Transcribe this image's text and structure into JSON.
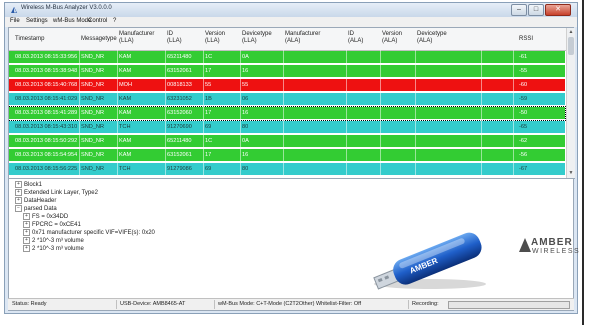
{
  "window": {
    "title": "Wireless M-Bus Analyzer V3.0.0.0",
    "buttons": {
      "minimize": "–",
      "maximize": "□",
      "close": "✕"
    }
  },
  "menu": [
    "File",
    "Settings",
    "wM-Bus Mode",
    "Control",
    "?"
  ],
  "table": {
    "headers": [
      "Timestamp",
      "Messagetype",
      "Manufacturer\n(LLA)",
      "ID\n(LLA)",
      "Version\n(LLA)",
      "Devicetype\n(LLA)",
      "Manufacturer\n(ALA)",
      "ID\n(ALA)",
      "Version\n(ALA)",
      "Devicetype\n(ALA)",
      "RSSI"
    ],
    "rows": [
      {
        "color": "green",
        "cells": [
          "08.03.2013 08:15:33:956",
          "SND_NR",
          "KAM",
          "65211480",
          "1C",
          "0A",
          "",
          "",
          "",
          "",
          "-61"
        ]
      },
      {
        "color": "green",
        "cells": [
          "08.03.2013 08:15:38:948",
          "SND_NR",
          "KAM",
          "63152061",
          "17",
          "16",
          "",
          "",
          "",
          "",
          "-55"
        ]
      },
      {
        "color": "red",
        "cells": [
          "08.03.2013 08:15:40:768",
          "SND_NR",
          "MOH",
          "00818133",
          "55",
          "55",
          "",
          "",
          "",
          "",
          "-60"
        ]
      },
      {
        "color": "teal",
        "cells": [
          "08.03.2013 08:15:41:029",
          "SND_NR",
          "KAM",
          "63231052",
          "1B",
          "06",
          "",
          "",
          "",
          "",
          "-59"
        ]
      },
      {
        "color": "green",
        "cells": [
          "08.03.2013 08:15:41:289",
          "SND_NR",
          "KAM",
          "63152060",
          "17",
          "16",
          "",
          "",
          "",
          "",
          "-50"
        ]
      },
      {
        "color": "teal",
        "cells": [
          "08.03.2013 08:15:43:310",
          "SND_NR",
          "TCH",
          "91270690",
          "69",
          "80",
          "",
          "",
          "",
          "",
          "-65"
        ]
      },
      {
        "color": "green",
        "cells": [
          "08.03.2013 08:15:50:292",
          "SND_NR",
          "KAM",
          "65211480",
          "1C",
          "0A",
          "",
          "",
          "",
          "",
          "-62"
        ]
      },
      {
        "color": "green",
        "cells": [
          "08.03.2013 08:15:54:954",
          "SND_NR",
          "KAM",
          "63152061",
          "17",
          "16",
          "",
          "",
          "",
          "",
          "-56"
        ]
      },
      {
        "color": "teal",
        "cells": [
          "08.03.2013 08:15:56:225",
          "SND_NR",
          "TCH",
          "91279086",
          "69",
          "80",
          "",
          "",
          "",
          "",
          "-67"
        ]
      }
    ]
  },
  "tree": [
    {
      "sign": "+",
      "label": "Block1"
    },
    {
      "sign": "+",
      "label": "Extended Link Layer, Type2"
    },
    {
      "sign": "+",
      "label": "DataHeader"
    },
    {
      "sign": "−",
      "label": "parsed Data"
    },
    {
      "sign": "+",
      "label": "FS = 0x34DD"
    },
    {
      "sign": "+",
      "label": "FPCRC = 0xCE41"
    },
    {
      "sign": "+",
      "label": "0x71 manufacturer specific VIF=VIFE(s): 0x20"
    },
    {
      "sign": "+",
      "label": "2 *10^-3 m³ volume"
    },
    {
      "sign": "+",
      "label": "2 *10^-3 m³ volume"
    }
  ],
  "logo": {
    "main": "AMBER",
    "sub": "WIRELESS"
  },
  "status": {
    "ready": "Status: Ready",
    "device": "USB-Device: AMB8465-AT",
    "mode": "wM-Bus Mode: C+T-Mode (C2T2Other)  Whitelist-Filter: Off",
    "recording": "Recording:"
  },
  "colors": {
    "green": "#33cc33",
    "red": "#ee1111",
    "teal": "#33cccc"
  }
}
